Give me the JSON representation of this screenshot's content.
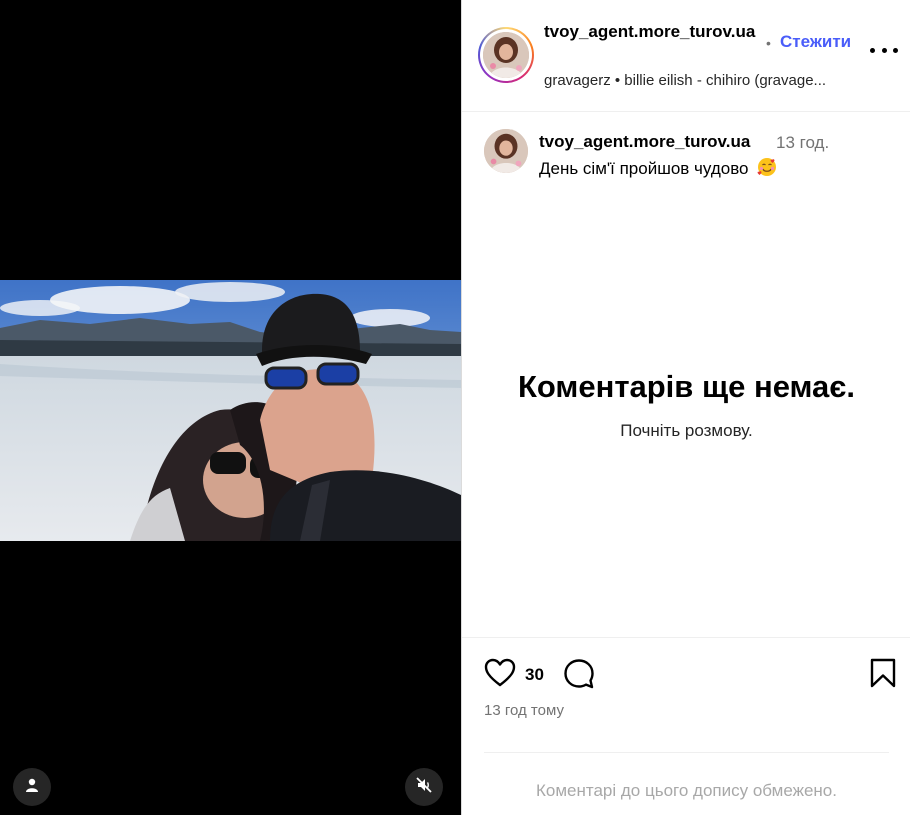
{
  "post": {
    "author": "tvoy_agent.more_turov.ua",
    "follow_label": "Стежити",
    "separator": "•",
    "audio": "gravagerz • billie eilish - chihiro (gravage...",
    "caption": {
      "username": "tvoy_agent.more_turov.ua",
      "time": "13 год.",
      "text": "День сім'ї пройшов чудово",
      "emoji": "smiling-face-with-hearts-emoji"
    },
    "empty_state": {
      "title": "Коментарів ще немає.",
      "subtitle": "Почніть розмову."
    },
    "likes": "30",
    "posted_ago": "13 год тому",
    "comments_limited": "Коментарі до цього допису обмежено."
  },
  "colors": {
    "follow": "#4a5df9",
    "muted_text": "#737373",
    "limited_text": "#a8a8a8",
    "media_bg": "#000000",
    "button_bg": "#262626"
  },
  "icons": [
    "user-icon",
    "muted-speaker-icon",
    "more-icon",
    "heart-icon",
    "comment-icon",
    "bookmark-icon"
  ]
}
